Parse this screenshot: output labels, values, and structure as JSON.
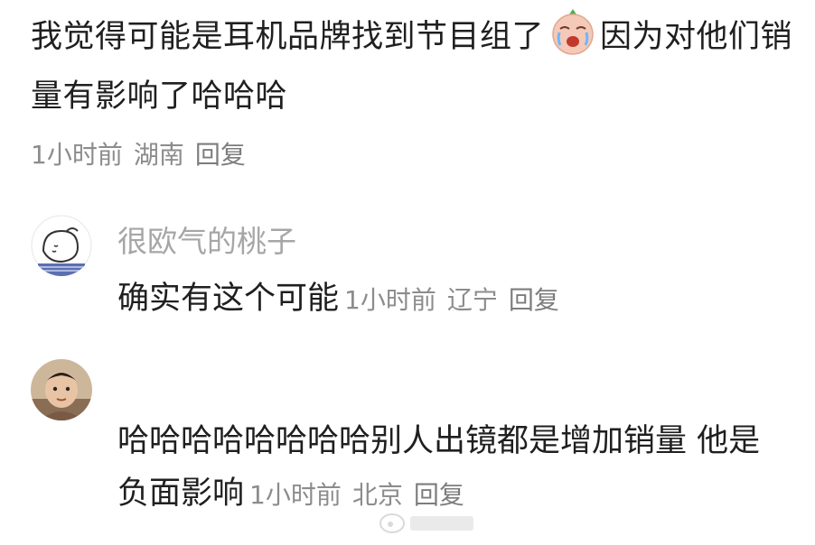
{
  "top_comment": {
    "text_part1": "我觉得可能是耳机品牌找到节目组了",
    "emoji": "crying-face-emoji",
    "text_part2": "因为对他们销量有影响了哈哈哈",
    "time": "1小时前",
    "location": "湖南",
    "reply_label": "回复"
  },
  "replies": [
    {
      "username": "很欧气的桃子",
      "text": "确实有这个可能",
      "time": "1小时前",
      "location": "辽宁",
      "reply_label": "回复"
    },
    {
      "username": "",
      "text": "哈哈哈哈哈哈哈哈别人出镜都是增加销量 他是负面影响",
      "time": "1小时前",
      "location": "北京",
      "reply_label": "回复"
    }
  ]
}
